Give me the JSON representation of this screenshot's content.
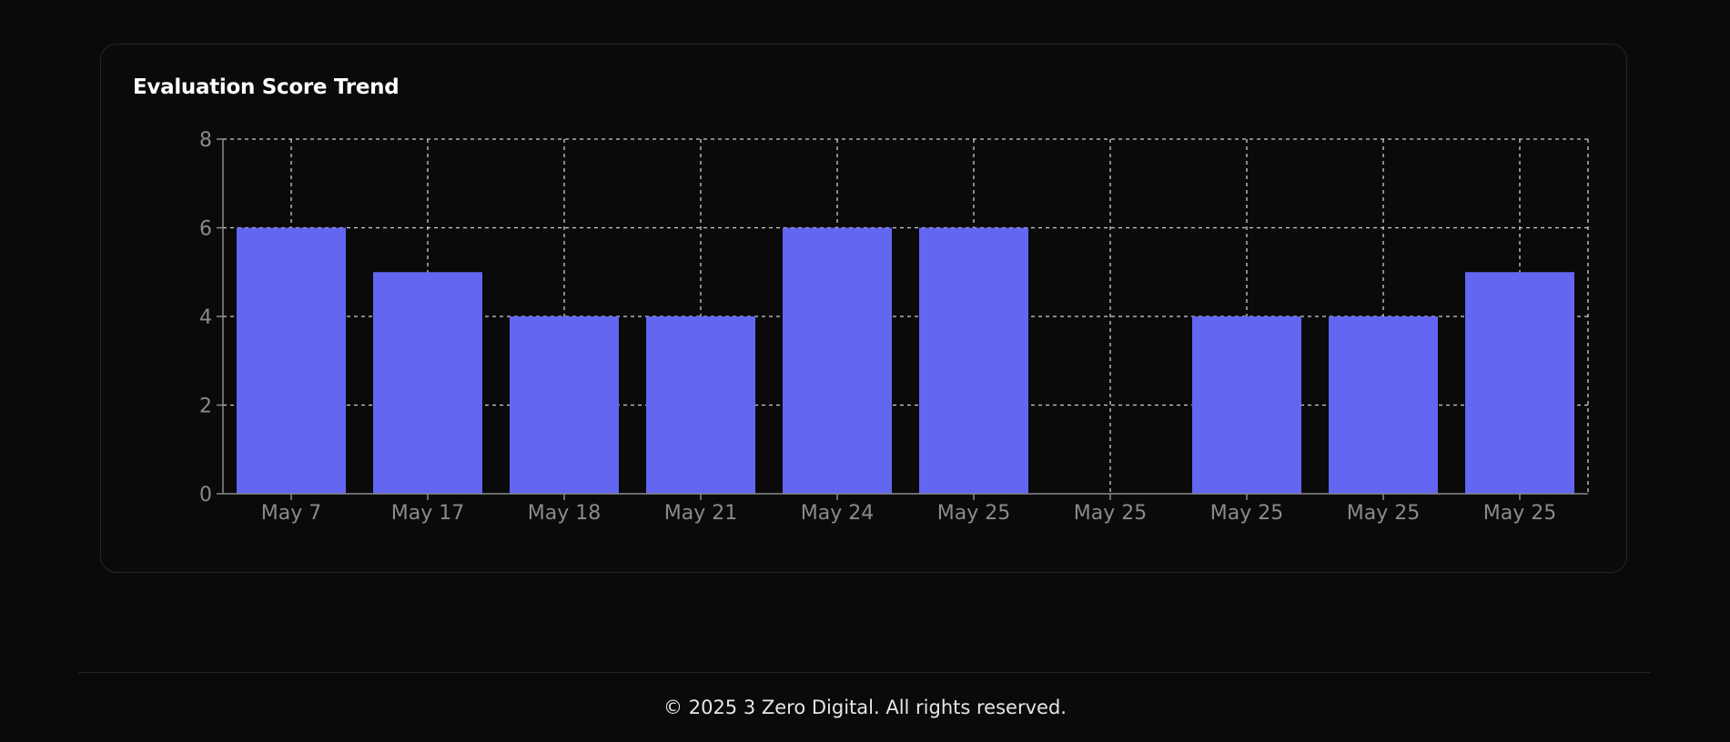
{
  "card": {
    "title": "Evaluation Score Trend"
  },
  "chart_data": {
    "type": "bar",
    "title": "Evaluation Score Trend",
    "categories": [
      "May 7",
      "May 17",
      "May 18",
      "May 21",
      "May 24",
      "May 25",
      "May 25",
      "May 25",
      "May 25",
      "May 25"
    ],
    "values": [
      6,
      5,
      4,
      4,
      6,
      6,
      0,
      4,
      4,
      5
    ],
    "xlabel": "",
    "ylabel": "",
    "ylim": [
      0,
      8
    ],
    "yticks": [
      0,
      2,
      4,
      6,
      8
    ],
    "grid": true,
    "bar_color": "#6366f1",
    "grid_color": "#cfcfcf",
    "axis_color": "#8a8a8a"
  },
  "footer": {
    "text": "© 2025 3 Zero Digital. All rights reserved."
  }
}
